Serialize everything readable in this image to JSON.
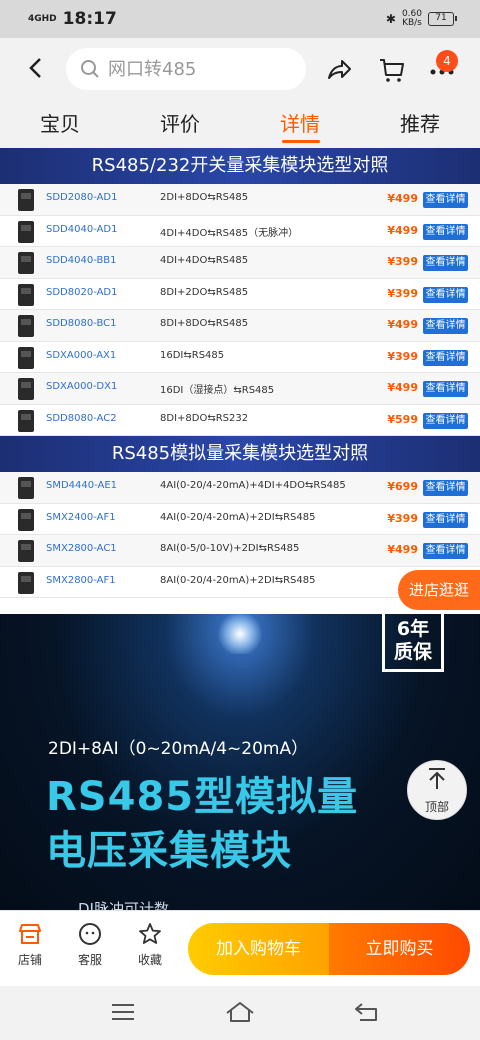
{
  "status_bar": {
    "signal": "4GHD",
    "time": "18:17",
    "speed_value": "0.60",
    "speed_unit": "KB/s",
    "battery": "71"
  },
  "search": {
    "placeholder": "网口转485"
  },
  "cart_badge": "4",
  "tabs": [
    {
      "label": "宝贝"
    },
    {
      "label": "评价"
    },
    {
      "label": "详情"
    },
    {
      "label": "推荐"
    }
  ],
  "section1": {
    "title": "RS485/232开关量采集模块选型对照",
    "rows": [
      {
        "model": "SDD2080-AD1",
        "desc": "2DI+8DO⇆RS485",
        "price": "¥499",
        "btn": "查看详情"
      },
      {
        "model": "SDD4040-AD1",
        "desc": "4DI+4DO⇆RS485（无脉冲）",
        "price": "¥499",
        "btn": "查看详情"
      },
      {
        "model": "SDD4040-BB1",
        "desc": "4DI+4DO⇆RS485",
        "price": "¥399",
        "btn": "查看详情"
      },
      {
        "model": "SDD8020-AD1",
        "desc": "8DI+2DO⇆RS485",
        "price": "¥399",
        "btn": "查看详情"
      },
      {
        "model": "SDD8080-BC1",
        "desc": "8DI+8DO⇆RS485",
        "price": "¥499",
        "btn": "查看详情"
      },
      {
        "model": "SDXA000-AX1",
        "desc": "16DI⇆RS485",
        "price": "¥399",
        "btn": "查看详情"
      },
      {
        "model": "SDXA000-DX1",
        "desc": "16DI（湿接点）⇆RS485",
        "price": "¥499",
        "btn": "查看详情"
      },
      {
        "model": "SDD8080-AC2",
        "desc": "8DI+8DO⇆RS232",
        "price": "¥599",
        "btn": "查看详情"
      }
    ]
  },
  "section2": {
    "title": "RS485模拟量采集模块选型对照",
    "rows": [
      {
        "model": "SMD4440-AE1",
        "desc": "4AI(0-20/4-20mA)+4DI+4DO⇆RS485",
        "price": "¥699",
        "btn": "查看详情"
      },
      {
        "model": "SMX2400-AF1",
        "desc": "4AI(0-20/4-20mA)+2DI⇆RS485",
        "price": "¥399",
        "btn": "查看详情"
      },
      {
        "model": "SMX2800-AC1",
        "desc": "8AI(0-5/0-10V)+2DI⇆RS485",
        "price": "¥499",
        "btn": "查看详情"
      },
      {
        "model": "SMX2800-AF1",
        "desc": "8AI(0-20/4-20mA)+2DI⇆RS485",
        "price": "",
        "btn": ""
      }
    ]
  },
  "banner": {
    "warranty_line1": "6年",
    "warranty_line2": "质保",
    "spec": "2DI+8AI（0~20mA/4~20mA）",
    "title_line1": "RS485型模拟量",
    "title_line2": "电压采集模块",
    "partial_text": "DI脉冲可计数"
  },
  "float_store": "进店逛逛",
  "float_top": "顶部",
  "actionbar": {
    "store": "店铺",
    "service": "客服",
    "favorite": "收藏",
    "add_cart": "加入购物车",
    "buy_now": "立即购买"
  },
  "colors": {
    "accent": "#ff5a00",
    "header_blue": "#1c2e73",
    "link_blue": "#2f6fd0",
    "banner_cyan": "#38c8e8"
  }
}
